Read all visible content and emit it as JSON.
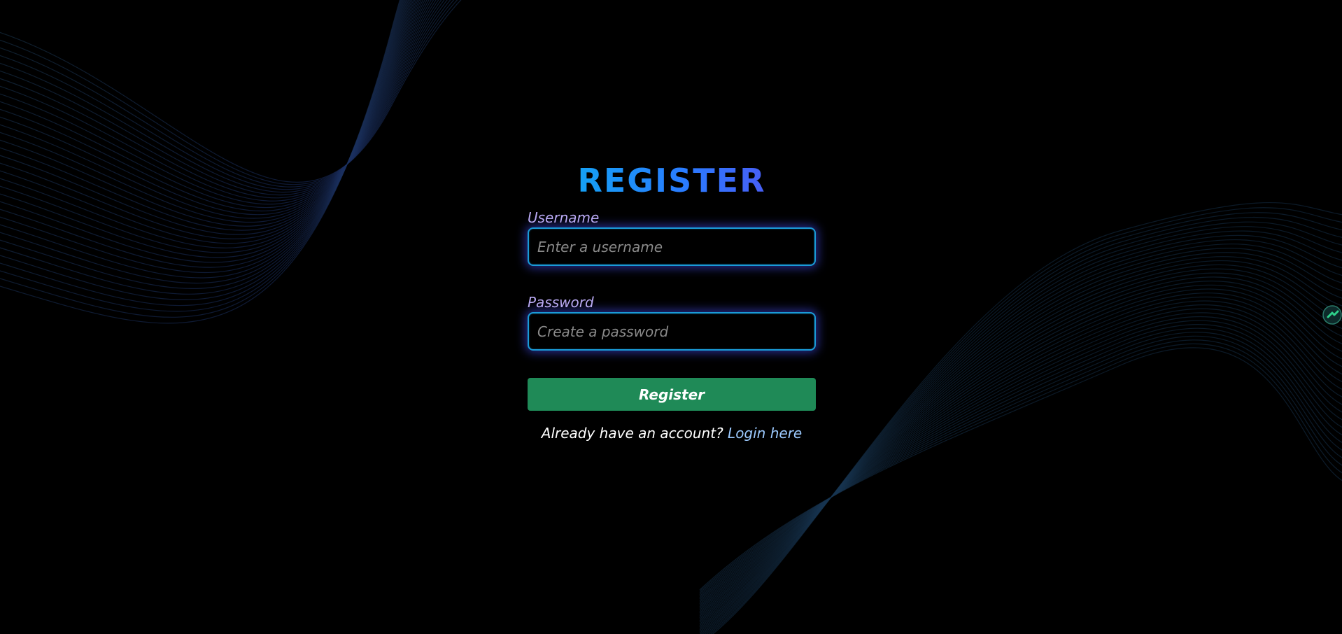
{
  "form": {
    "title": "REGISTER",
    "username_label": "Username",
    "username_placeholder": "Enter a username",
    "username_value": "",
    "password_label": "Password",
    "password_placeholder": "Create a password",
    "password_value": "",
    "submit_label": "Register"
  },
  "footer": {
    "prompt": "Already have an account?",
    "link_label": "Login here"
  },
  "colors": {
    "background": "#000000",
    "title_gradient_start": "#0bb2f0",
    "title_gradient_end": "#5a4df0",
    "input_border": "#1a9bd8",
    "input_glow": "#4650ff",
    "label": "#b9a9f3",
    "button": "#1f8a57",
    "link": "#9ccaff"
  },
  "icons": {
    "extension_badge": "grammar-extension-icon"
  }
}
